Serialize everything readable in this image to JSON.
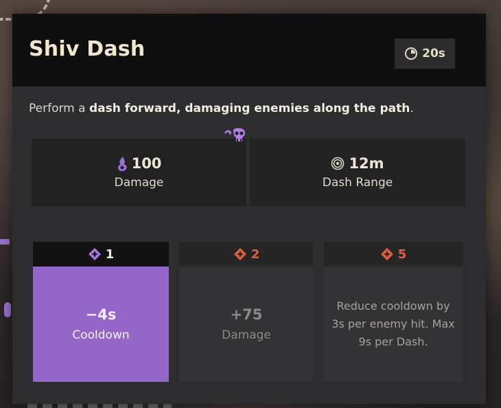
{
  "ability": {
    "name": "Shiv Dash",
    "cooldown": "20s",
    "description_prefix": "Perform a ",
    "description_bold": "dash forward, damaging enemies along the path",
    "description_suffix": "."
  },
  "stats": [
    {
      "value": "100",
      "label": "Damage",
      "icon": "spirit-damage-icon"
    },
    {
      "value": "12m",
      "label": "Dash Range",
      "icon": "range-target-icon"
    }
  ],
  "upgrades": [
    {
      "cost": "1",
      "value": "−4s",
      "label": "Cooldown",
      "active": true
    },
    {
      "cost": "2",
      "value": "+75",
      "label": "Damage",
      "active": false
    },
    {
      "cost": "5",
      "text": "Reduce cooldown by 3s per enemy hit. Max 9s per Dash.",
      "active": false
    }
  ],
  "colors": {
    "accent_purple": "#9566c9",
    "upgrade_cost_orange": "#e2603f",
    "title_cream": "#f1e6cf"
  }
}
